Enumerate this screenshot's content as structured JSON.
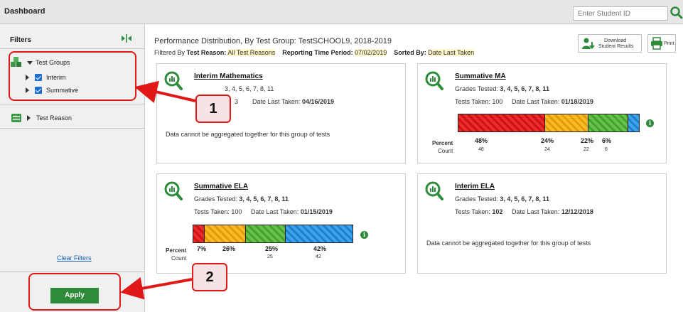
{
  "header": {
    "title": "Dashboard",
    "student_id_placeholder": "Enter Student ID"
  },
  "sidebar": {
    "title": "Filters",
    "test_groups_label": "Test Groups",
    "items": [
      {
        "label": "Interim",
        "checked": true
      },
      {
        "label": "Summative",
        "checked": true
      }
    ],
    "test_reason_label": "Test Reason",
    "clear_label": "Clear Filters",
    "apply_label": "Apply"
  },
  "main": {
    "heading": "Performance Distribution, By Test Group: TestSCHOOL9, 2018-2019",
    "filtered_by_label": "Filtered By",
    "test_reason_key": "Test Reason:",
    "test_reason_value": "All Test Reasons",
    "period_key": "Reporting Time Period:",
    "period_value": "07/02/2019",
    "sorted_key": "Sorted By:",
    "sorted_value": "Date Last Taken",
    "download_label_1": "Download",
    "download_label_2": "Student Results",
    "print_label": "Print"
  },
  "cards": [
    {
      "title": "Interim Mathematics",
      "grades_partial": "3, 4, 5, 6, 7, 8, 11",
      "tests_partial": "3",
      "date_key": "Date Last Taken:",
      "date": "04/16/2019",
      "message": "Data cannot be aggregated together for this group of tests"
    },
    {
      "title": "Summative MA",
      "grades_key": "Grades Tested:",
      "grades": "3, 4, 5, 6, 7, 8, 11",
      "tests_key": "Tests Taken:",
      "tests": "100",
      "date_key": "Date Last Taken:",
      "date": "01/18/2019",
      "percent_label": "Percent",
      "count_label": "Count",
      "percents": [
        "48%",
        "24%",
        "22%",
        "6%"
      ],
      "counts": [
        "48",
        "24",
        "22",
        "6"
      ],
      "values": [
        48,
        24,
        22,
        6
      ]
    },
    {
      "title": "Summative ELA",
      "grades_key": "Grades Tested:",
      "grades": "3, 4, 5, 6, 7, 8, 11",
      "tests_key": "Tests Taken:",
      "tests": "100",
      "date_key": "Date Last Taken:",
      "date": "01/15/2019",
      "percent_label": "Percent",
      "count_label": "Count",
      "percents": [
        "7%",
        "26%",
        "25%",
        "42%"
      ],
      "counts": [
        "25",
        "42"
      ],
      "values": [
        7,
        26,
        25,
        42
      ]
    },
    {
      "title": "Interim ELA",
      "grades_key": "Grades Tested:",
      "grades": "3, 4, 5, 6, 7, 8, 11",
      "tests_key": "Tests Taken:",
      "tests": "102",
      "date_key": "Date Last Taken:",
      "date": "12/12/2018",
      "message": "Data cannot be aggregated together for this group of tests"
    }
  ],
  "callouts": [
    "1",
    "2"
  ],
  "colors": {
    "apply_green": "#2e8b3a",
    "checkbox_blue": "#1f6fd0",
    "callout_red": "#e01818",
    "highlight": "#fdf7c9"
  },
  "icons": [
    "search-icon",
    "collapse-panel-icon",
    "test-groups-icon",
    "test-reason-icon",
    "download-icon",
    "print-icon",
    "analytics-magnifier-icon",
    "info-icon"
  ]
}
